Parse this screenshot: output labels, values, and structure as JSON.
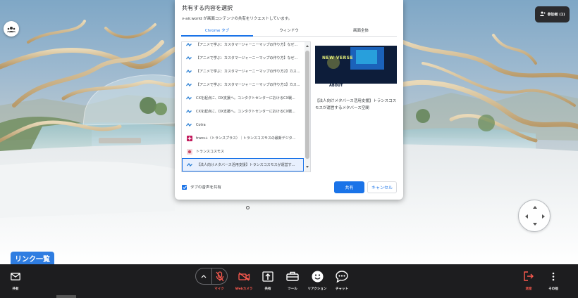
{
  "dialog": {
    "title": "共有する内容を選択",
    "subtitle": "v-air.world が画面コンテンツの共有をリクエストしています。",
    "tabs": [
      {
        "label": "Chrome タブ",
        "active": true
      },
      {
        "label": "ウィンドウ",
        "active": false
      },
      {
        "label": "画面全体",
        "active": false
      }
    ],
    "tab_items": [
      {
        "title": "【アニメで学ぶ：カスタマージャーニーマップの作り方】なぜ...",
        "icon": "wave-icon",
        "selected": false
      },
      {
        "title": "【アニメで学ぶ：カスタマージャーニーマップの作り方3】カス...",
        "icon": "wave-icon",
        "selected": false
      },
      {
        "title": "【アニメで学ぶ：カスタマージャーニーマップの作り方2】カス...",
        "icon": "wave-icon",
        "selected": false
      },
      {
        "title": "【アニメで学ぶ：カスタマージャーニーマップの作り方1】カス...",
        "icon": "wave-icon",
        "selected": false
      },
      {
        "title": "CXを起点に、DX支援へ。コンタクトセンターにおけるCX戦...",
        "icon": "wave-icon",
        "selected": false
      },
      {
        "title": "CXを起点に、DX支援へ。コンタクトセンターにおけるCX戦...",
        "icon": "wave-icon",
        "selected": false
      },
      {
        "title": "Cotra",
        "icon": "wave-icon",
        "selected": false
      },
      {
        "title": "trans+（トランスプラス）｜トランスコスモスの最新デジタ...",
        "icon": "trans-plus-icon",
        "selected": false
      },
      {
        "title": "トランスコスモス",
        "icon": "transcosmos-icon",
        "selected": false
      },
      {
        "title": "【法人向けメタバース活用支援】トランスコスモスが運営す...",
        "icon": "wave-icon",
        "selected": true
      }
    ],
    "preview": {
      "caption": "【法人向けメタバース活用支援】トランスコスモスが運営するメタバース空間",
      "logo_text": "NEW VERSE",
      "section_text": "ABOUT"
    },
    "audio_label": "タブの音声を共有",
    "audio_checked": true,
    "share_label": "共有",
    "cancel_label": "キャンセル"
  },
  "participants_label": "参加者 (1)",
  "link_list_label": "リンク一覧",
  "toolbar": {
    "share_left_label": "共有",
    "mic_label": "マイク",
    "camera_label": "Webカメラ",
    "share_label": "共有",
    "tools_label": "ツール",
    "reaction_label": "リアクション",
    "chat_label": "チャット",
    "leave_label": "退室",
    "more_label": "その他"
  },
  "colors": {
    "accent": "#1a73e8",
    "toolbar_bg": "#1d1d1f",
    "danger": "#ff5a4f",
    "link_list_bg": "#2f7de1"
  }
}
